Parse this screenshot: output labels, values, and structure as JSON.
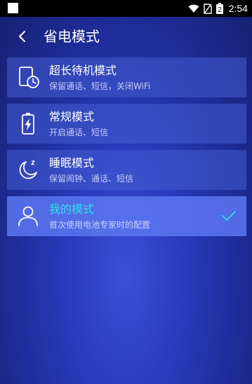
{
  "status_bar": {
    "time": "2:54",
    "battery_level": "2"
  },
  "header": {
    "title": "省电模式"
  },
  "modes": [
    {
      "title": "超长待机模式",
      "description": "保留通话、短信，关闭WiFi",
      "icon": "standby-clock-icon",
      "selected": false
    },
    {
      "title": "常规模式",
      "description": "开启通话、短信",
      "icon": "battery-bolt-icon",
      "selected": false
    },
    {
      "title": "睡眠模式",
      "description": "保留闹钟、通话、短信",
      "icon": "moon-sleep-icon",
      "selected": false
    },
    {
      "title": "我的模式",
      "description": "首次使用电池专家时的配置",
      "icon": "user-icon",
      "selected": true
    }
  ],
  "colors": {
    "accent": "#2de0f0",
    "selected_bg": "#5c76f0",
    "item_bg": "#465cd2"
  }
}
